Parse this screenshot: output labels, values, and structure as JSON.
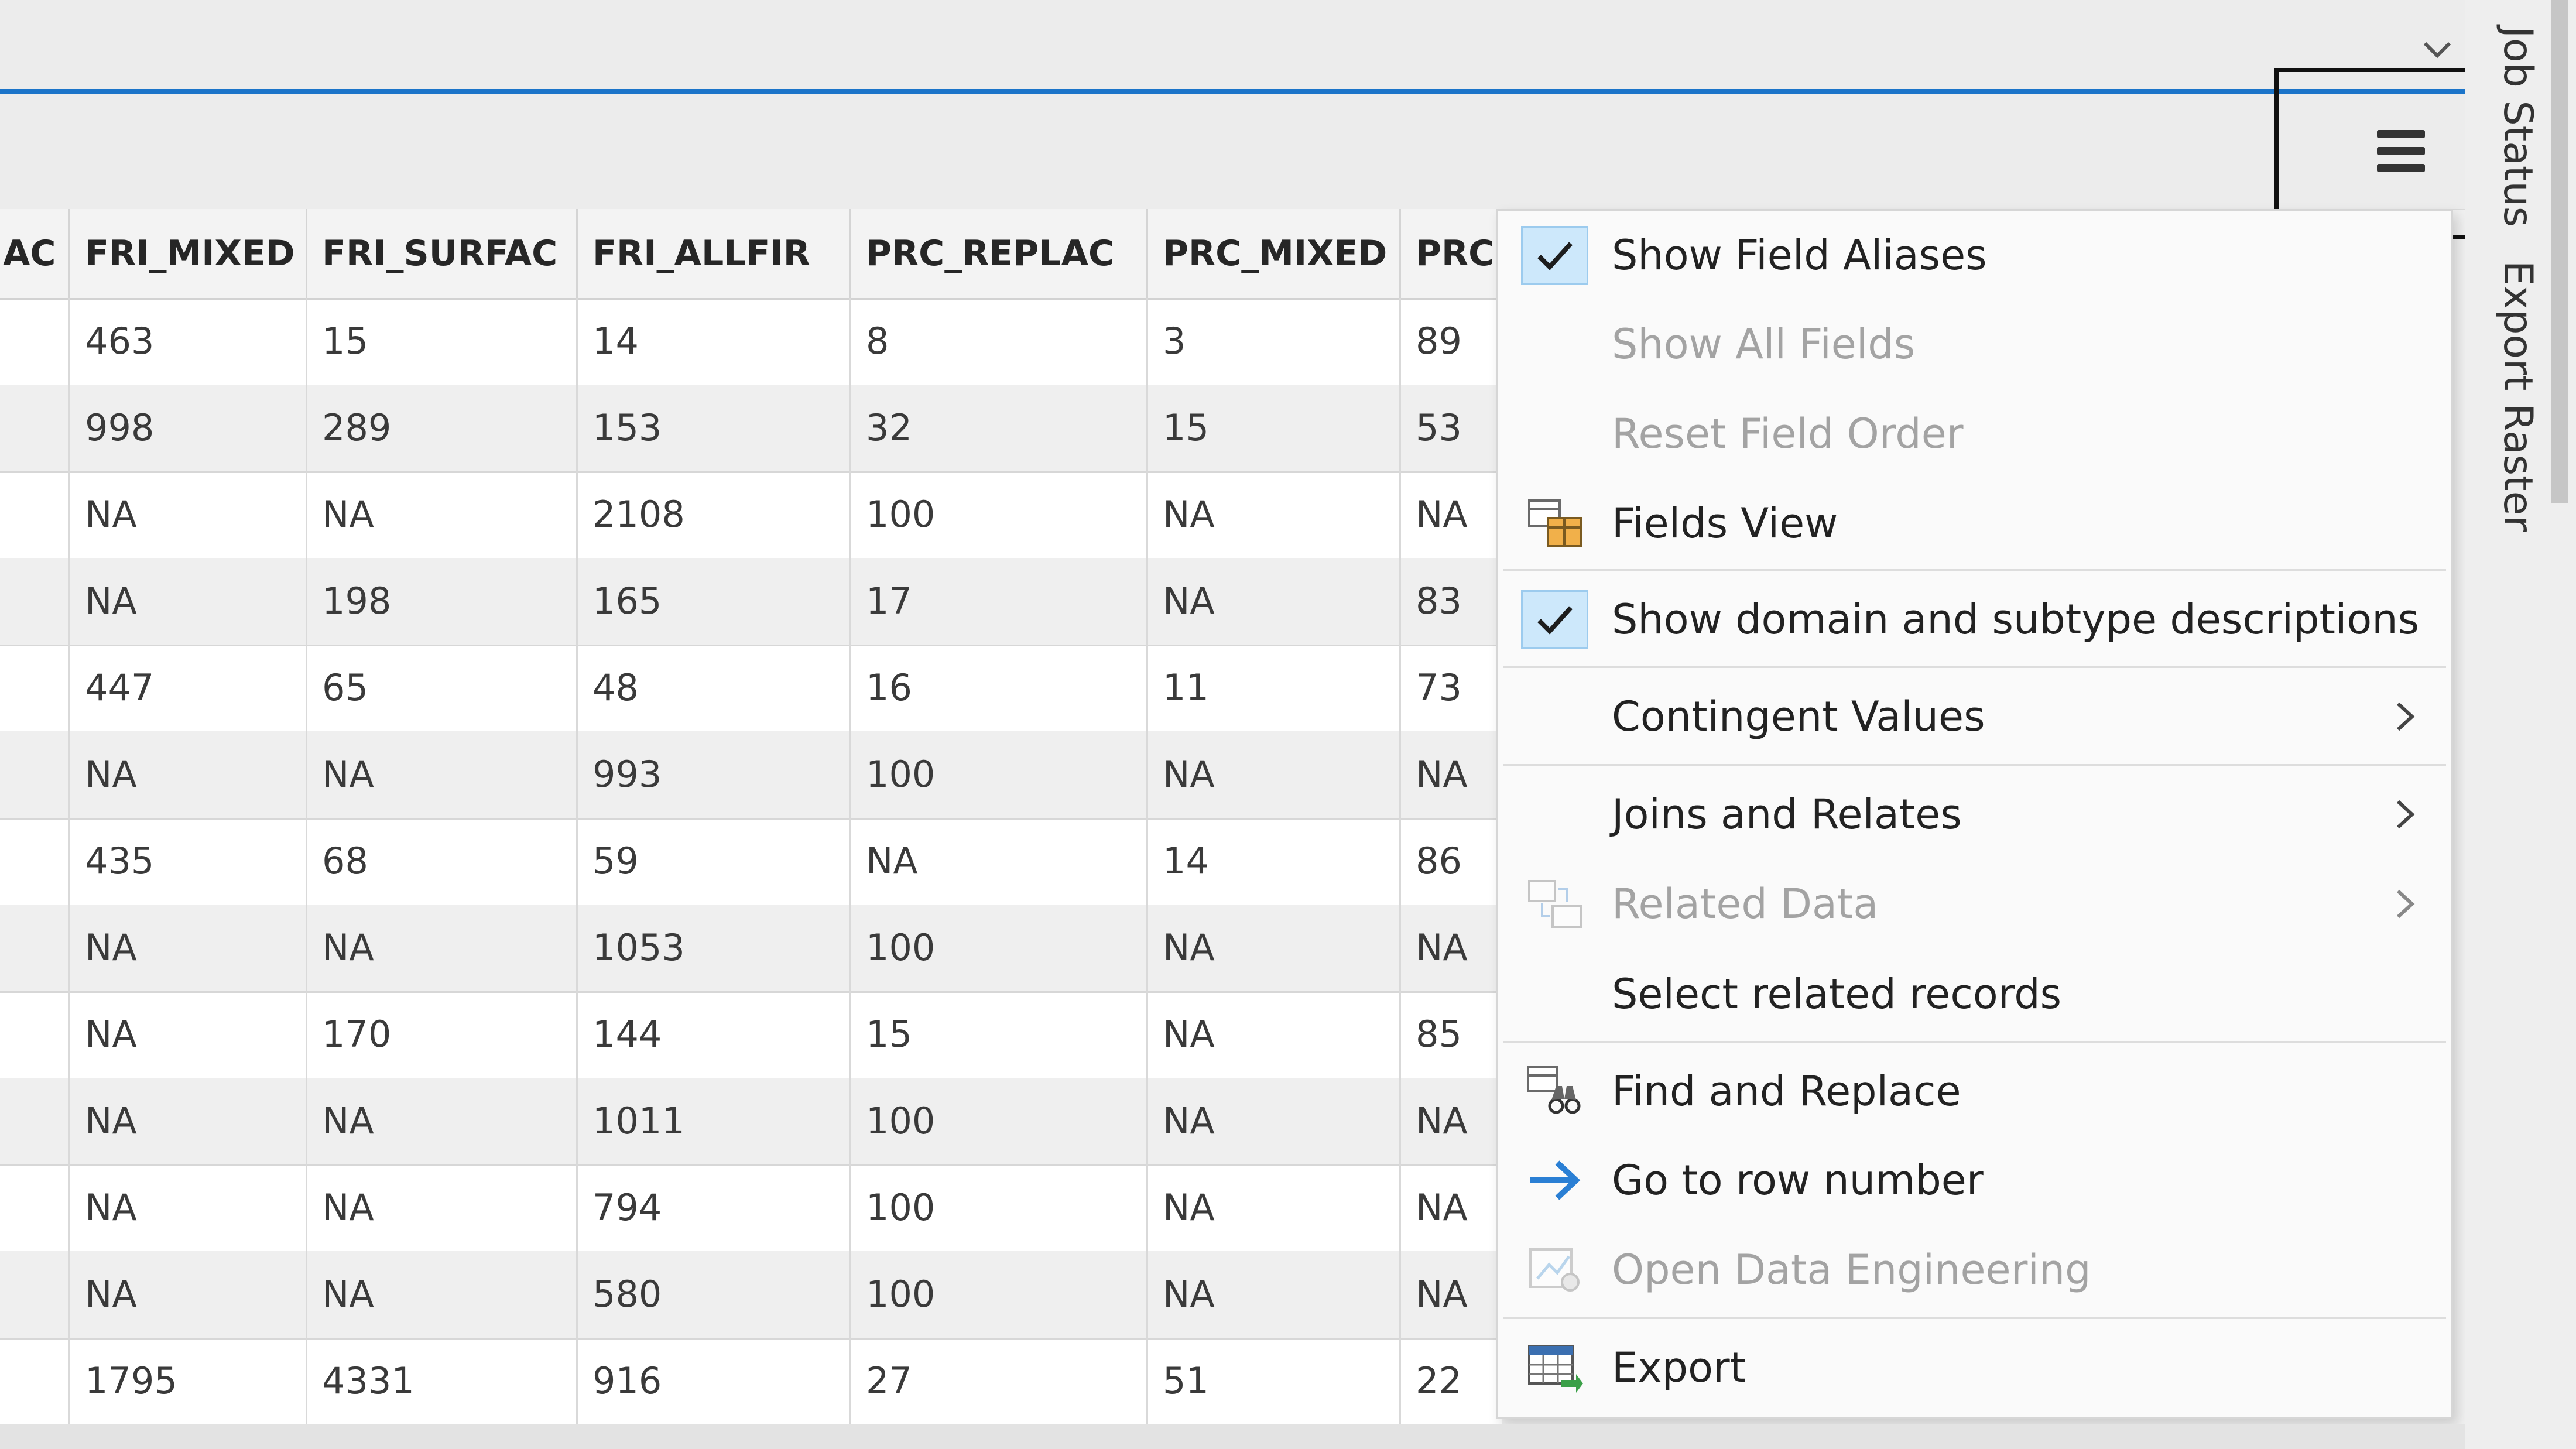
{
  "toolbar": {
    "menu_button": "hamburger-menu-icon",
    "collapse": "chevron-down-icon"
  },
  "side_panel": {
    "tab_job_status": "Job Status",
    "tab_export_raster": "Export Raster"
  },
  "table": {
    "columns": [
      "AC",
      "FRI_MIXED",
      "FRI_SURFAC",
      "FRI_ALLFIR",
      "PRC_REPLAC",
      "PRC_MIXED",
      "PRC"
    ],
    "rows": [
      [
        "",
        "463",
        "15",
        "14",
        "8",
        "3",
        "89"
      ],
      [
        "",
        "998",
        "289",
        "153",
        "32",
        "15",
        "53"
      ],
      [
        "",
        "NA",
        "NA",
        "2108",
        "100",
        "NA",
        "NA"
      ],
      [
        "",
        "NA",
        "198",
        "165",
        "17",
        "NA",
        "83"
      ],
      [
        "",
        "447",
        "65",
        "48",
        "16",
        "11",
        "73"
      ],
      [
        "",
        "NA",
        "NA",
        "993",
        "100",
        "NA",
        "NA"
      ],
      [
        "",
        "435",
        "68",
        "59",
        "NA",
        "14",
        "86"
      ],
      [
        "",
        "NA",
        "NA",
        "1053",
        "100",
        "NA",
        "NA"
      ],
      [
        "",
        "NA",
        "170",
        "144",
        "15",
        "NA",
        "85"
      ],
      [
        "",
        "NA",
        "NA",
        "1011",
        "100",
        "NA",
        "NA"
      ],
      [
        "",
        "NA",
        "NA",
        "794",
        "100",
        "NA",
        "NA"
      ],
      [
        "",
        "NA",
        "NA",
        "580",
        "100",
        "NA",
        "NA"
      ],
      [
        "",
        "1795",
        "4331",
        "916",
        "27",
        "51",
        "22"
      ]
    ]
  },
  "menu": {
    "items": [
      {
        "label": "Show Field Aliases",
        "icon": "checkmark-icon",
        "checked": true,
        "enabled": true
      },
      {
        "label": "Show All Fields",
        "enabled": false
      },
      {
        "label": "Reset Field Order",
        "enabled": false
      },
      {
        "label": "Fields View",
        "icon": "fields-view-icon",
        "enabled": true
      },
      {
        "label": "Show domain and subtype descriptions",
        "icon": "checkmark-icon",
        "checked": true,
        "enabled": true
      },
      {
        "label": "Contingent Values",
        "enabled": true,
        "submenu": true
      },
      {
        "label": "Joins and Relates",
        "enabled": true,
        "submenu": true
      },
      {
        "label": "Related Data",
        "icon": "related-data-icon",
        "enabled": false,
        "submenu": true
      },
      {
        "label": "Select related records",
        "enabled": true
      },
      {
        "label": "Find and Replace",
        "icon": "find-replace-icon",
        "enabled": true
      },
      {
        "label": "Go to row number",
        "icon": "arrow-right-icon",
        "enabled": true
      },
      {
        "label": "Open Data Engineering",
        "icon": "data-engineering-icon",
        "enabled": false
      },
      {
        "label": "Export",
        "icon": "export-table-icon",
        "enabled": true
      }
    ]
  },
  "colors": {
    "accent": "#1b74c9",
    "check_bg": "#cde8fb",
    "disabled_text": "#a3a3a3",
    "arrow": "#2a7fd4"
  }
}
